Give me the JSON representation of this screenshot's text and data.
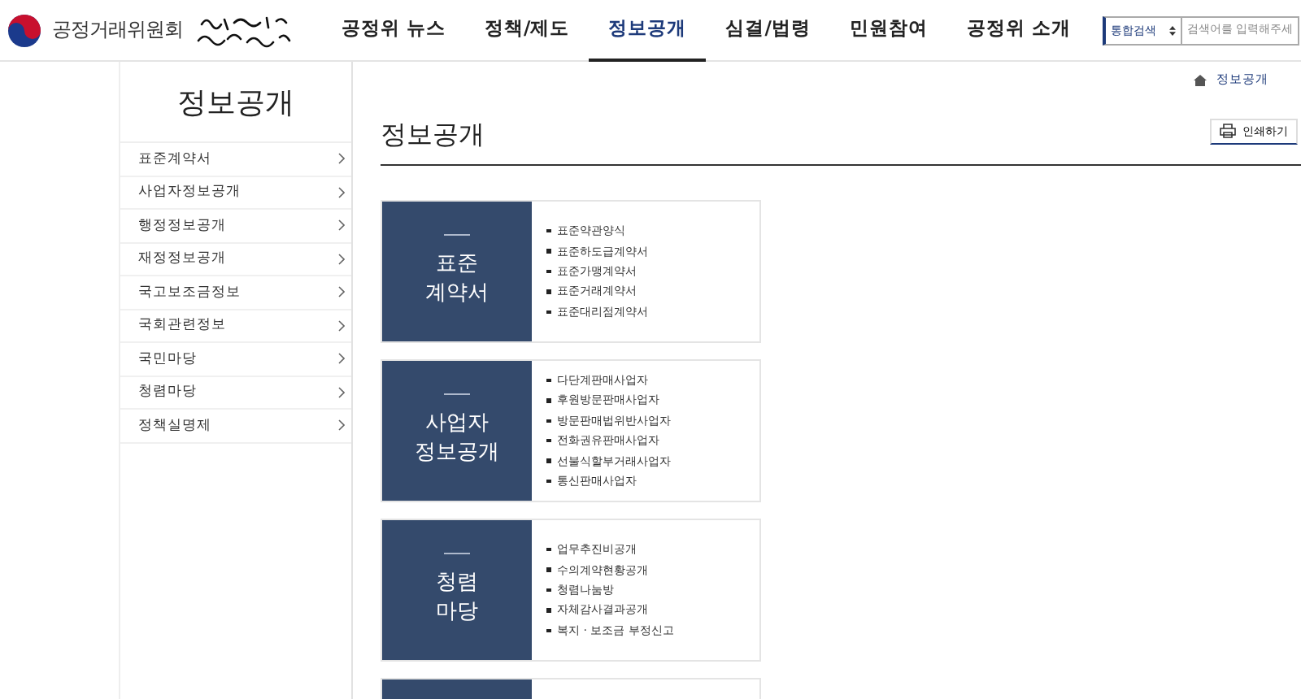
{
  "header": {
    "org_name": "공정거래위원회",
    "nav": [
      {
        "label": "공정위 뉴스",
        "selected": false
      },
      {
        "label": "정책/제도",
        "selected": false
      },
      {
        "label": "정보공개",
        "selected": true
      },
      {
        "label": "심결/법령",
        "selected": false
      },
      {
        "label": "민원참여",
        "selected": false
      },
      {
        "label": "공정위 소개",
        "selected": false
      }
    ],
    "search": {
      "scope": "통합검색",
      "placeholder": "검색어를 입력해주세"
    }
  },
  "sidebar": {
    "title": "정보공개",
    "items": [
      {
        "label": "표준계약서",
        "selected": false
      },
      {
        "label": "사업자정보공개",
        "selected": false
      },
      {
        "label": "행정정보공개",
        "selected": false
      },
      {
        "label": "재정정보공개",
        "selected": false
      },
      {
        "label": "국고보조금정보",
        "selected": false
      },
      {
        "label": "국회관련정보",
        "selected": false
      },
      {
        "label": "국민마당",
        "selected": false
      },
      {
        "label": "청렴마당",
        "selected": false
      },
      {
        "label": "정책실명제",
        "selected": false
      }
    ]
  },
  "breadcrumb": "정보공개",
  "page_title": "정보공개",
  "print_button": "인쇄하기",
  "cards": [
    {
      "title": [
        "표준",
        "계약서"
      ],
      "links": [
        "표준약관양식",
        "표준하도급계약서",
        "표준가맹계약서",
        "표준거래계약서",
        "표준대리점계약서"
      ]
    },
    {
      "title": [
        "사업자",
        "정보공개"
      ],
      "links": [
        "다단계판매사업자",
        "후원방문판매사업자",
        "방문판매법위반사업자",
        "전화권유판매사업자",
        "선불식할부거래사업자",
        "통신판매사업자"
      ]
    },
    {
      "title": [
        "청렴",
        "마당"
      ],
      "links": [
        "업무추진비공개",
        "수의계약현황공개",
        "청렴나눔방",
        "자체감사결과공개",
        "복지 · 보조금 부정신고"
      ]
    }
  ]
}
